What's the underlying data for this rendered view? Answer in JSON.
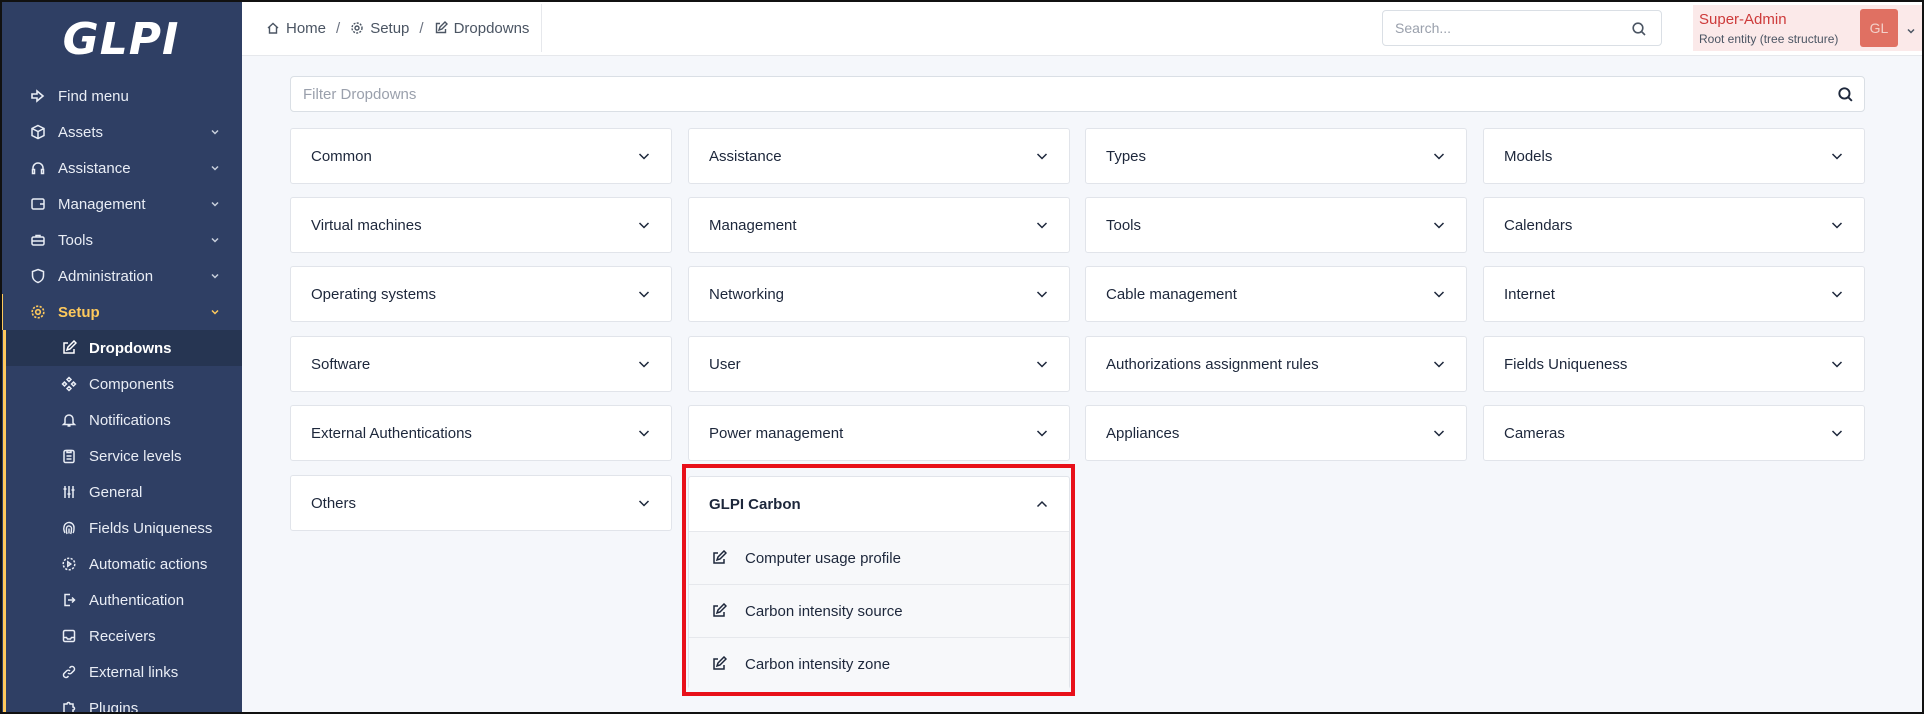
{
  "app": {
    "logo": "GLPI"
  },
  "sidebar": {
    "items": [
      {
        "label": "Find menu",
        "icon": "arrow-right-icon",
        "expandable": false
      },
      {
        "label": "Assets",
        "icon": "box-icon",
        "expandable": true
      },
      {
        "label": "Assistance",
        "icon": "headset-icon",
        "expandable": true
      },
      {
        "label": "Management",
        "icon": "wallet-icon",
        "expandable": true
      },
      {
        "label": "Tools",
        "icon": "briefcase-icon",
        "expandable": true
      },
      {
        "label": "Administration",
        "icon": "shield-icon",
        "expandable": true
      },
      {
        "label": "Setup",
        "icon": "gear-icon",
        "expandable": true,
        "active": true
      }
    ],
    "setup_items": [
      {
        "label": "Dropdowns",
        "icon": "edit-icon",
        "current": true
      },
      {
        "label": "Components",
        "icon": "components-icon"
      },
      {
        "label": "Notifications",
        "icon": "bell-icon"
      },
      {
        "label": "Service levels",
        "icon": "clipboard-icon"
      },
      {
        "label": "General",
        "icon": "sliders-icon"
      },
      {
        "label": "Fields Uniqueness",
        "icon": "fingerprint-icon"
      },
      {
        "label": "Automatic actions",
        "icon": "cog-play-icon"
      },
      {
        "label": "Authentication",
        "icon": "login-icon"
      },
      {
        "label": "Receivers",
        "icon": "inbox-icon"
      },
      {
        "label": "External links",
        "icon": "link-icon"
      },
      {
        "label": "Plugins",
        "icon": "puzzle-icon"
      }
    ]
  },
  "header": {
    "breadcrumb": [
      {
        "label": "Home",
        "icon": "home-icon"
      },
      {
        "label": "Setup",
        "icon": "gear-icon"
      },
      {
        "label": "Dropdowns",
        "icon": "edit-icon"
      }
    ],
    "search_placeholder": "Search...",
    "user": {
      "name": "Super-Admin",
      "entity": "Root entity (tree structure)",
      "initials": "GL"
    }
  },
  "main": {
    "filter_placeholder": "Filter Dropdowns",
    "categories": [
      "Common",
      "Assistance",
      "Types",
      "Models",
      "Virtual machines",
      "Management",
      "Tools",
      "Calendars",
      "Operating systems",
      "Networking",
      "Cable management",
      "Internet",
      "Software",
      "User",
      "Authorizations assignment rules",
      "Fields Uniqueness",
      "External Authentications",
      "Power management",
      "Appliances",
      "Cameras",
      "Others"
    ],
    "expanded": {
      "title": "GLPI Carbon",
      "items": [
        "Computer usage profile",
        "Carbon intensity source",
        "Carbon intensity zone"
      ]
    }
  },
  "colors": {
    "sidebar": "#2f3f64",
    "active": "#fec95c",
    "highlight": "#e8101a",
    "user_name": "#cd3a3a"
  }
}
